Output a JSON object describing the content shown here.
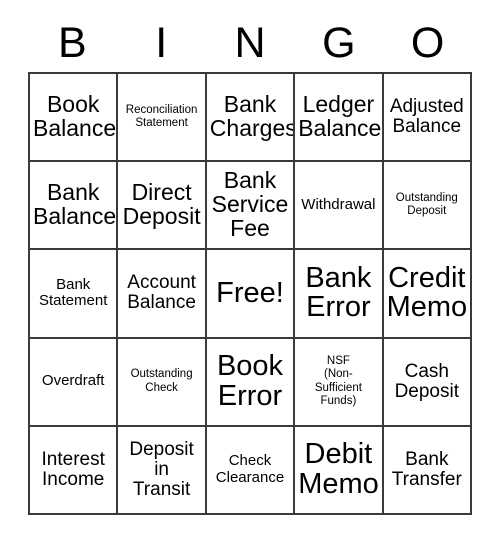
{
  "card": {
    "type": "bingo-card",
    "header_letters": [
      "B",
      "I",
      "N",
      "G",
      "O"
    ],
    "grid_size": "5x5",
    "colors": {
      "background": "#ffffff",
      "text": "#000000",
      "border": "#3a3a3a"
    }
  },
  "grid": {
    "rows": [
      [
        {
          "label": "Book\nBalance",
          "size": "fs-lg"
        },
        {
          "label": "Reconciliation\nStatement",
          "size": "fs-xs"
        },
        {
          "label": "Bank\nCharges",
          "size": "fs-lg"
        },
        {
          "label": "Ledger\nBalance",
          "size": "fs-lg"
        },
        {
          "label": "Adjusted\nBalance",
          "size": "fs-md"
        }
      ],
      [
        {
          "label": "Bank\nBalance",
          "size": "fs-lg"
        },
        {
          "label": "Direct\nDeposit",
          "size": "fs-lg"
        },
        {
          "label": "Bank\nService\nFee",
          "size": "fs-lg"
        },
        {
          "label": "Withdrawal",
          "size": "fs-sm"
        },
        {
          "label": "Outstanding\nDeposit",
          "size": "fs-xs"
        }
      ],
      [
        {
          "label": "Bank\nStatement",
          "size": "fs-sm"
        },
        {
          "label": "Account\nBalance",
          "size": "fs-md"
        },
        {
          "label": "Free!",
          "size": "fs-xl"
        },
        {
          "label": "Bank\nError",
          "size": "fs-xl"
        },
        {
          "label": "Credit\nMemo",
          "size": "fs-xl"
        }
      ],
      [
        {
          "label": "Overdraft",
          "size": "fs-sm"
        },
        {
          "label": "Outstanding\nCheck",
          "size": "fs-xs"
        },
        {
          "label": "Book\nError",
          "size": "fs-xl"
        },
        {
          "label": "NSF\n(Non-\nSufficient\nFunds)",
          "size": "fs-xs"
        },
        {
          "label": "Cash\nDeposit",
          "size": "fs-md"
        }
      ],
      [
        {
          "label": "Interest\nIncome",
          "size": "fs-md"
        },
        {
          "label": "Deposit\nin\nTransit",
          "size": "fs-md"
        },
        {
          "label": "Check\nClearance",
          "size": "fs-sm"
        },
        {
          "label": "Debit\nMemo",
          "size": "fs-xl"
        },
        {
          "label": "Bank\nTransfer",
          "size": "fs-md"
        }
      ]
    ]
  }
}
